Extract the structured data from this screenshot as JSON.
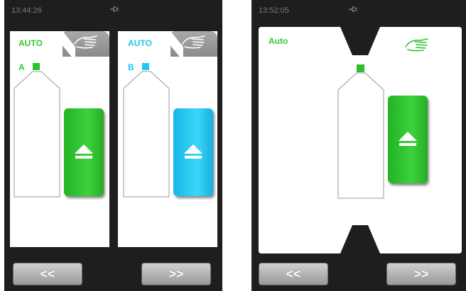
{
  "left_screen": {
    "time": "13:44:26",
    "slot_a": {
      "mode_label": "AUTO",
      "slot_label": "A"
    },
    "slot_b": {
      "mode_label": "AUTO",
      "slot_label": "B"
    },
    "nav": {
      "prev_label": "<<",
      "next_label": ">>"
    }
  },
  "right_screen": {
    "time": "13:52:05",
    "mode_label": "Auto",
    "nav": {
      "prev_label": "<<",
      "next_label": ">>"
    }
  },
  "icons": {
    "status": "plug-icon",
    "manual": "hand-icon",
    "eject": "eject-icon"
  },
  "colors": {
    "slot_a": "#2fbf2f",
    "slot_b": "#1ec8f0",
    "auto_green": "#34c734",
    "auto_blue": "#1ec8f0",
    "screen_bg": "#1e1e1e"
  }
}
